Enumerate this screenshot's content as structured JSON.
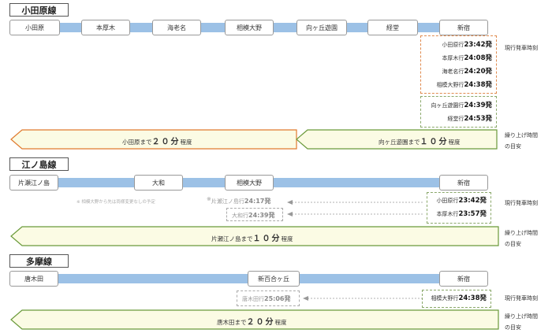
{
  "odakyu": {
    "title": "小田原線",
    "stations": [
      "小田原",
      "本厚木",
      "海老名",
      "相模大野",
      "向ヶ丘遊園",
      "経堂",
      "新宿"
    ],
    "departures_a": [
      {
        "dest": "小田原行",
        "time": "23:42発"
      },
      {
        "dest": "本厚木行",
        "time": "24:08発"
      },
      {
        "dest": "海老名行",
        "time": "24:20発"
      },
      {
        "dest": "相模大野行",
        "time": "24:38発"
      }
    ],
    "departures_b": [
      {
        "dest": "向ヶ丘遊園行",
        "time": "24:39発"
      },
      {
        "dest": "経堂行",
        "time": "24:53発"
      }
    ],
    "current_label": "現行発車時刻",
    "banner_left": {
      "pre": "小田原まで",
      "strong": "２０分",
      "post": "程度"
    },
    "banner_right": {
      "pre": "向ヶ丘遊園まで",
      "strong": "１０分",
      "post": "程度"
    },
    "side_label": [
      "繰り上げ時間",
      "の目安"
    ]
  },
  "enoshima": {
    "title": "江ノ島線",
    "stations": [
      "片瀬江ノ島",
      "大和",
      "相模大野",
      "新宿"
    ],
    "departures": [
      {
        "dest": "小田原行",
        "time": "23:42発"
      },
      {
        "dest": "本厚木行",
        "time": "23:57発"
      }
    ],
    "moved": [
      {
        "mark": "※",
        "dest": "片瀬江ノ島行",
        "time": "24:17発"
      },
      {
        "dest": "大和行",
        "time": "24:39発"
      }
    ],
    "note": "※ 相模大野から先は両様変更なしの予定",
    "current_label": "現行発車時刻",
    "banner": {
      "pre": "片瀬江ノ島まで",
      "strong": "１０分",
      "post": "程度"
    },
    "side_label": [
      "繰り上げ時間",
      "の目安"
    ]
  },
  "tama": {
    "title": "多摩線",
    "stations": [
      "唐木田",
      "新百合ヶ丘",
      "新宿"
    ],
    "departures": [
      {
        "dest": "相模大野行",
        "time": "24:38発"
      }
    ],
    "moved": [
      {
        "dest": "唐木田行",
        "time": "25:06発"
      }
    ],
    "current_label": "現行発車時刻",
    "banner": {
      "pre": "唐木田まで",
      "strong": "２０分",
      "post": "程度"
    },
    "side_label": [
      "繰り上げ時間",
      "の目安"
    ]
  },
  "colors": {
    "track": "#9cc1e6",
    "banner_fill": "#fbfbe4",
    "orange": "#e07a2e",
    "green": "#6a9a3a",
    "arrow": "#888888"
  }
}
